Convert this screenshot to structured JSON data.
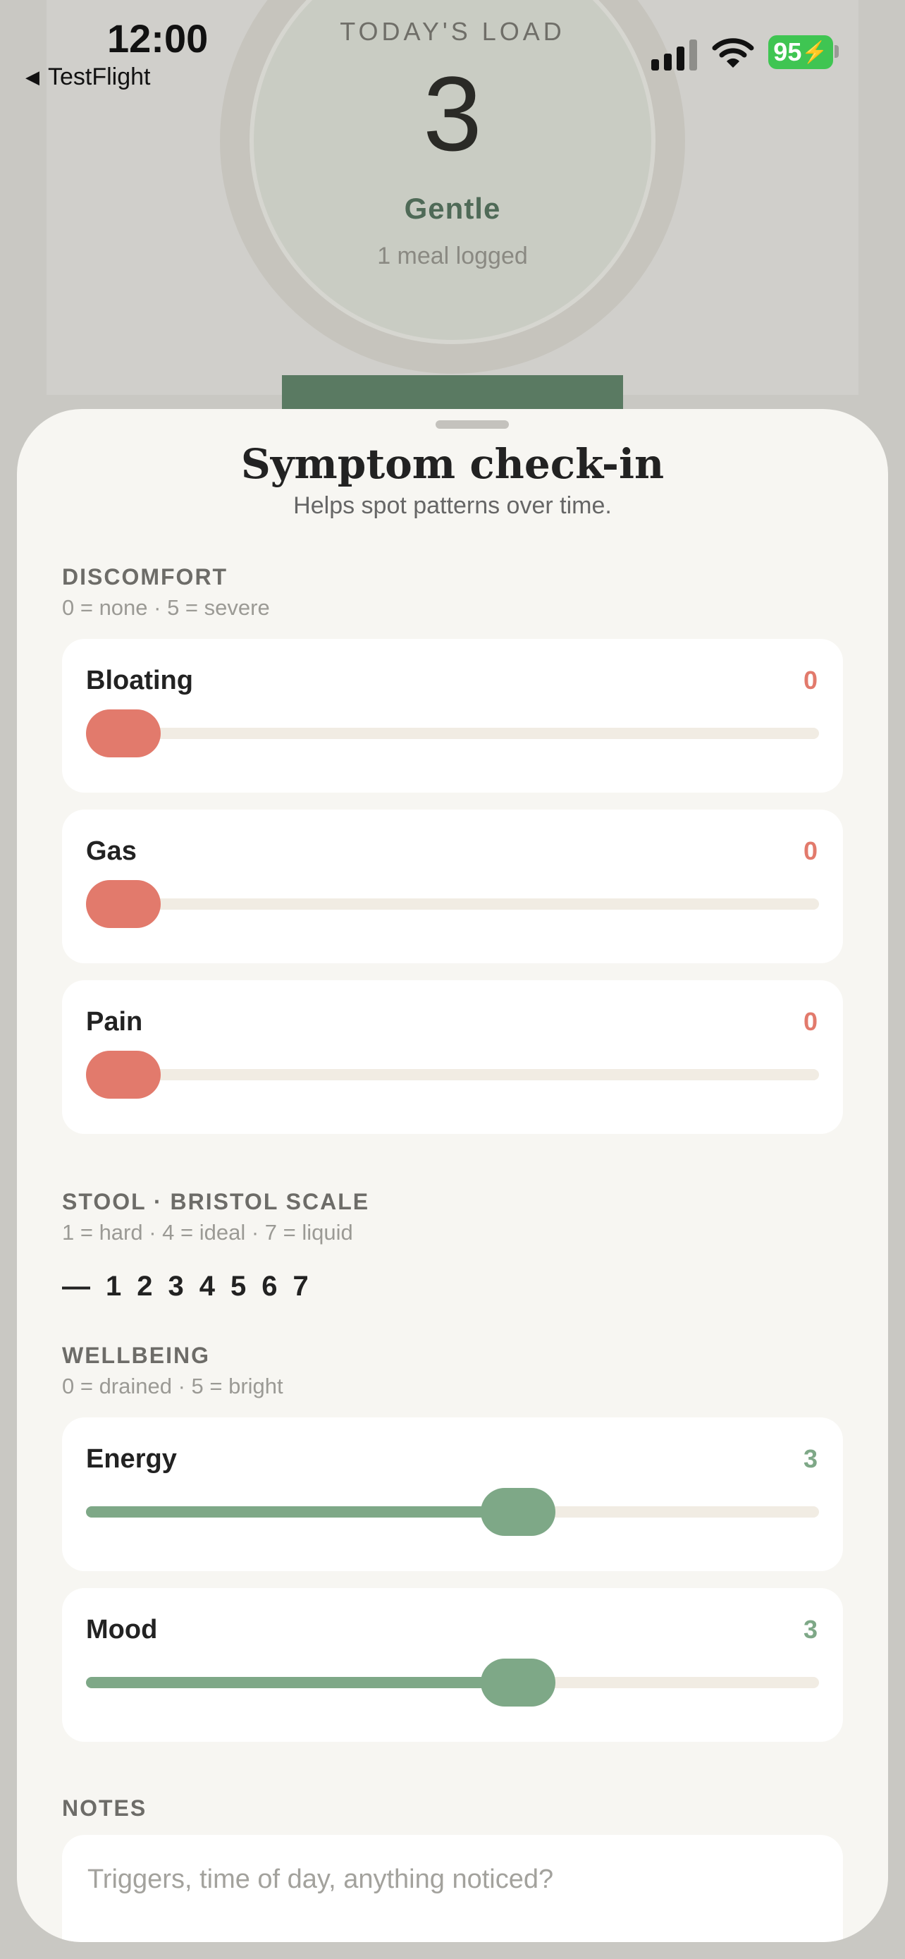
{
  "status_bar": {
    "time": "12:00",
    "back_label": "TestFlight",
    "battery": "95"
  },
  "background": {
    "title": "TODAY'S LOAD",
    "value": "3",
    "level": "Gentle",
    "meals": "1 meal logged"
  },
  "sheet": {
    "title": "Symptom check-in",
    "subtitle": "Helps spot patterns over time."
  },
  "discomfort": {
    "heading": "DISCOMFORT",
    "hint": "0 = none · 5 = severe",
    "color": "#e27a6c",
    "items": [
      {
        "label": "Bloating",
        "value": "0",
        "level": 0
      },
      {
        "label": "Gas",
        "value": "0",
        "level": 0
      },
      {
        "label": "Pain",
        "value": "0",
        "level": 0
      }
    ]
  },
  "stool": {
    "heading": "STOOL · BRISTOL SCALE",
    "hint": "1 = hard · 4 = ideal · 7 = liquid",
    "options": [
      "—",
      "1",
      "2",
      "3",
      "4",
      "5",
      "6",
      "7"
    ]
  },
  "wellbeing": {
    "heading": "WELLBEING",
    "hint": "0 = drained · 5 = bright",
    "color": "#7ea887",
    "items": [
      {
        "label": "Energy",
        "value": "3",
        "level": 0.6
      },
      {
        "label": "Mood",
        "value": "3",
        "level": 0.6
      }
    ]
  },
  "notes": {
    "heading": "NOTES",
    "placeholder": "Triggers, time of day, anything noticed?"
  }
}
